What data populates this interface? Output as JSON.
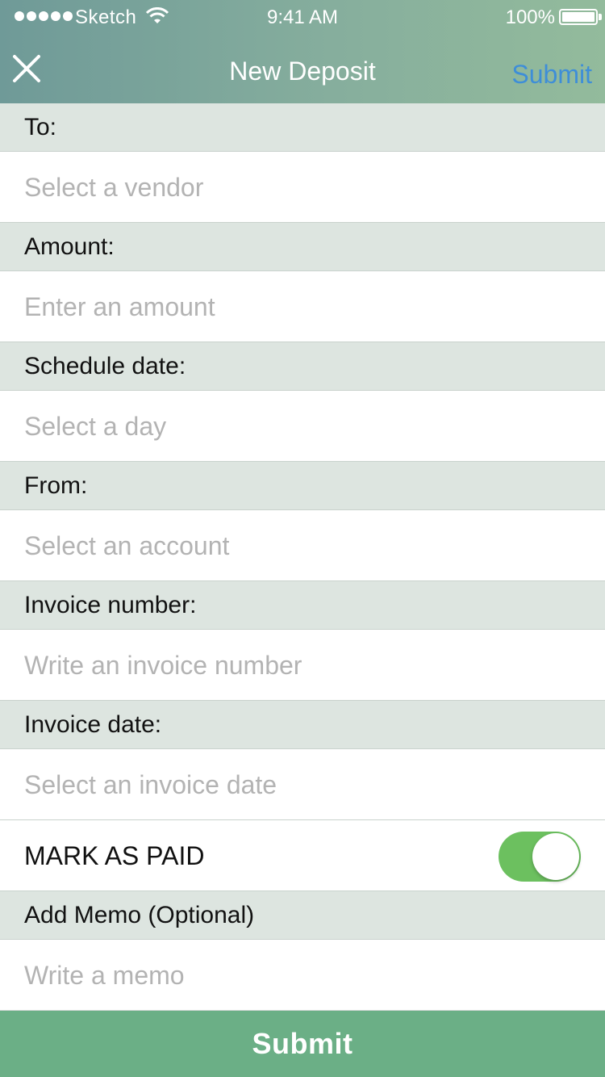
{
  "status_bar": {
    "carrier": "Sketch",
    "time": "9:41 AM",
    "battery": "100%"
  },
  "nav": {
    "title": "New Deposit",
    "submit_label": "Submit",
    "close_icon": "close-icon"
  },
  "form": {
    "to_label": "To:",
    "to_placeholder": "Select a vendor",
    "amount_label": "Amount:",
    "amount_placeholder": "Enter an amount",
    "schedule_label": "Schedule date:",
    "schedule_placeholder": "Select a day",
    "from_label": "From:",
    "from_placeholder": "Select an account",
    "invoice_number_label": "Invoice number:",
    "invoice_number_placeholder": "Write an invoice number",
    "invoice_date_label": "Invoice date:",
    "invoice_date_placeholder": "Select an invoice date",
    "mark_paid_label": "MARK AS PAID",
    "mark_paid_on": true,
    "memo_label": "Add Memo (Optional)",
    "memo_placeholder": "Write a memo"
  },
  "footer": {
    "submit_label": "Submit"
  },
  "colors": {
    "accent": "#3e8ed8",
    "toggle_on": "#6cc05f",
    "submit_bg": "#6baf86",
    "section_bg": "#dde5e0"
  }
}
